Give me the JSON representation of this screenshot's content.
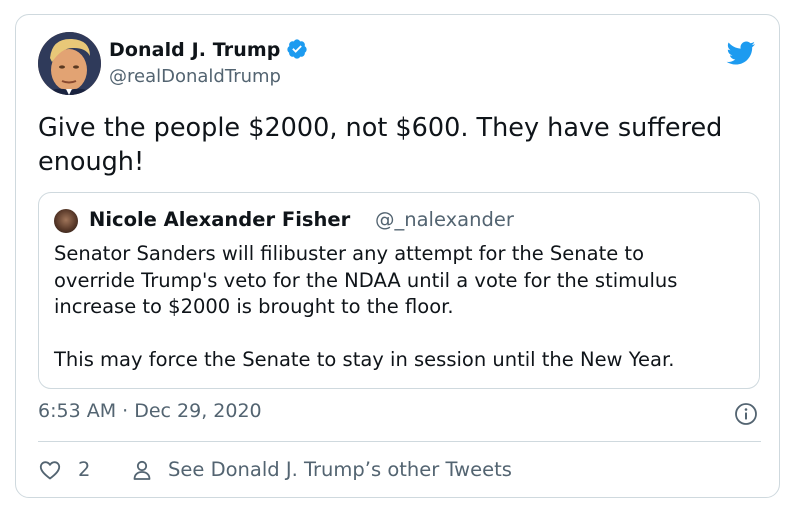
{
  "author": {
    "name": "Donald J. Trump",
    "handle": "@realDonaldTrump",
    "verified": true
  },
  "tweet": {
    "text": "Give the people $2000, not $600. They have suffered\nenough!"
  },
  "quoted_tweet": {
    "author_name": "Nicole Alexander Fisher",
    "author_handle": "@_nalexander",
    "text": "Senator Sanders will filibuster any attempt for the Senate to\noverride Trump's veto for the NDAA until a vote for the stimulus\nincrease to $2000 is brought to the floor.\n\nThis may force the Senate to stay in session until the New Year."
  },
  "meta": {
    "timestamp": "6:53 AM · Dec 29, 2020"
  },
  "actions": {
    "like_count": "2",
    "profile_link": "See Donald J. Trump’s other Tweets"
  },
  "icons": {
    "brand": "twitter-bird-icon",
    "verified": "verified-badge-icon",
    "info": "info-icon",
    "like": "heart-icon",
    "profile": "person-icon"
  },
  "colors": {
    "brand_blue": "#1d9bf0",
    "secondary_text": "#536471",
    "border": "#cfd9de",
    "primary_text": "#0f1419"
  }
}
